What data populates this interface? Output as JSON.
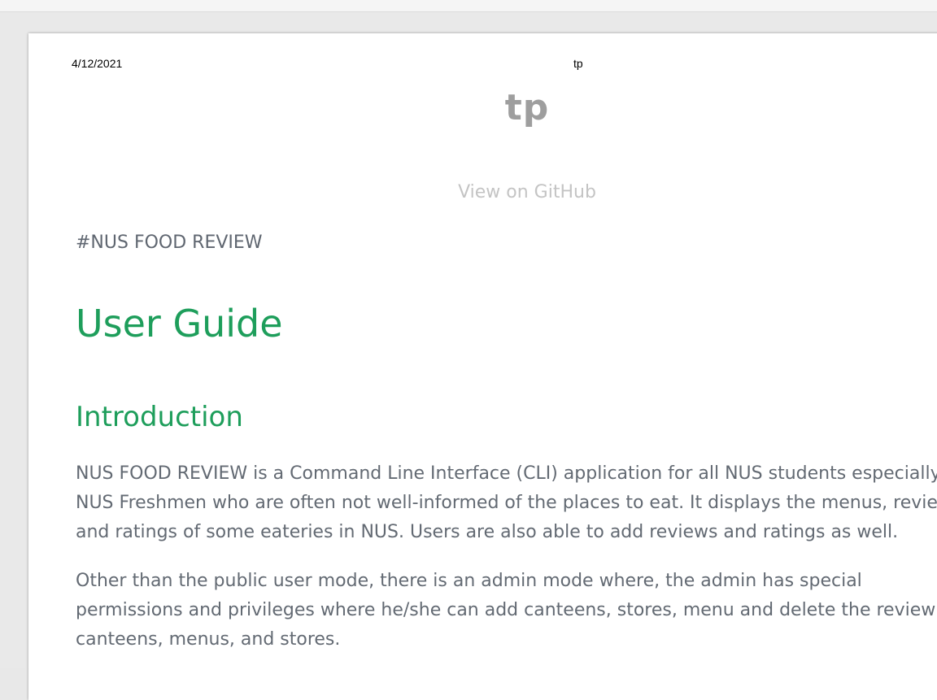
{
  "print_header": {
    "date": "4/12/2021",
    "title": "tp"
  },
  "site": {
    "title": "tp",
    "github_link": "View on GitHub"
  },
  "content": {
    "project_heading": "#NUS FOOD REVIEW",
    "h1": "User Guide",
    "h2": "Introduction",
    "paragraph1": [
      "NUS FOOD REVIEW is a Command Line Interface (CLI) application for all NUS students especially",
      "NUS Freshmen who are often not well-informed of the places to eat. It displays the menus, revie",
      "and ratings of some eateries in NUS. Users are also able to add reviews and ratings as well."
    ],
    "paragraph2": [
      "Other than the public user mode, there is an admin mode where, the admin has special",
      "permissions and privileges where he/she can add canteens, stores, menu and delete the review",
      "canteens, menus, and stores."
    ]
  },
  "colors": {
    "heading_green": "#1e9e5b",
    "body_text": "#636a73",
    "site_title": "#9e9e9e",
    "link_muted": "#c4c4c4"
  }
}
